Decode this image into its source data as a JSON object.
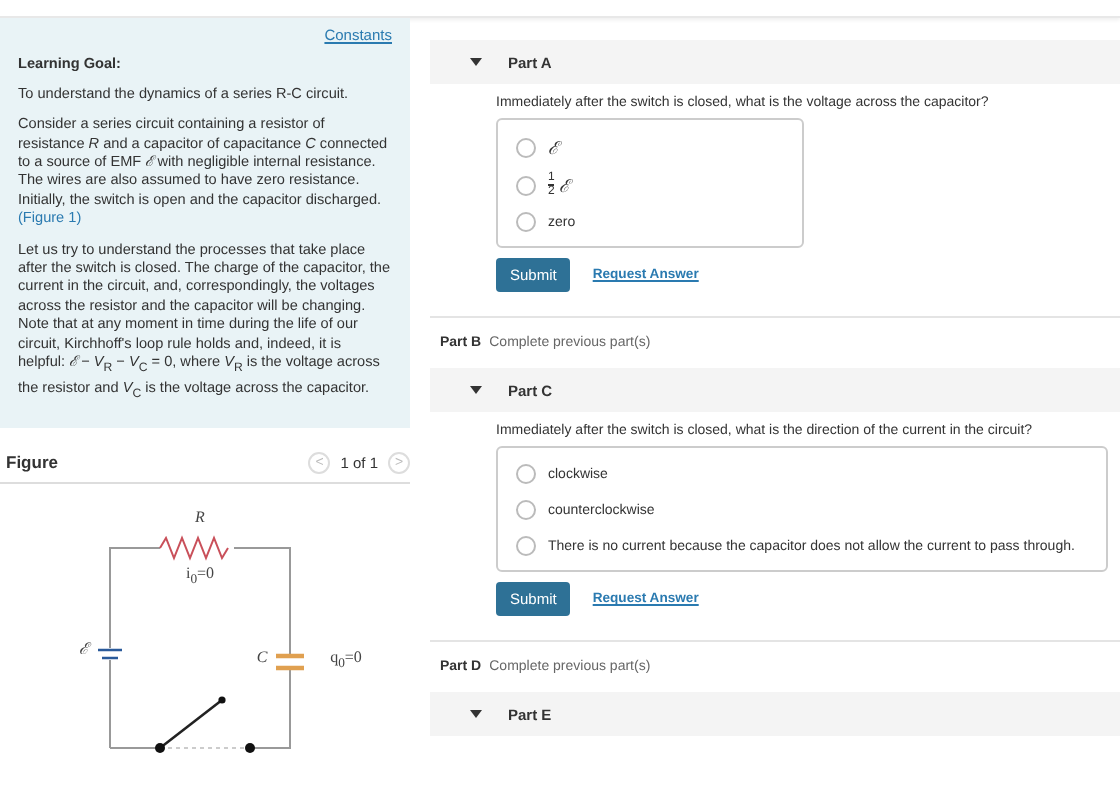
{
  "constants_link": "Constants",
  "intro": {
    "heading": "Learning Goal:",
    "paragraphs": [
      "To understand the dynamics of a series R-C circuit.",
      "Consider a series circuit containing a resistor of resistance *R* and a capacitor of capacitance *C* connected to a source of EMF *ℰ* with negligible internal resistance. The wires are also assumed to have zero resistance. Initially, the switch is open and the capacitor discharged.",
      "Let us try to understand the processes that take place after the switch is closed. The charge of the capacitor, the current in the circuit, and, correspondingly, the voltages across the resistor and the capacitor will be changing. Note that at any moment in time during the life of our circuit, Kirchhoff's loop rule holds and, indeed, it is helpful: *ℰ* − *V*$_{R}$ − *V*$_{C}$ = 0, where *V*$_{R}$ is the voltage across the resistor and *V*$_{C}$ is the voltage across the capacitor."
    ],
    "figure_link": "(Figure 1)"
  },
  "figure": {
    "title": "Figure",
    "pager": "1 of 1",
    "prev": "<",
    "next": ">",
    "labels": {
      "resistor": "R",
      "current": "i$_{0}$=0",
      "emf": "ℰ",
      "capacitor": "C",
      "charge": "q$_{0}$=0"
    }
  },
  "parts": [
    {
      "kind": "open",
      "title": "Part A",
      "question": "Immediately after the switch is closed, what is the voltage across the capacitor?",
      "options": [
        {
          "kind": "text",
          "label": "ℰ",
          "selected": false
        },
        {
          "kind": "fraction",
          "numerator": "1",
          "denominator": "2",
          "label": "ℰ",
          "selected": false
        },
        {
          "kind": "text",
          "label": "zero",
          "selected": false
        }
      ],
      "submit": "Submit",
      "request": "Request Answer"
    },
    {
      "kind": "locked",
      "title": "Part B",
      "note": "Complete previous part(s)"
    },
    {
      "kind": "open",
      "title": "Part C",
      "question": "Immediately after the switch is closed, what is the direction of the current in the circuit?",
      "options": [
        {
          "kind": "text",
          "label": "clockwise",
          "selected": false
        },
        {
          "kind": "text",
          "label": "counterclockwise",
          "selected": false
        },
        {
          "kind": "text",
          "label": "There is no current because the capacitor does not allow the current to pass through.",
          "selected": false
        }
      ],
      "submit": "Submit",
      "request": "Request Answer"
    },
    {
      "kind": "locked",
      "title": "Part D",
      "note": "Complete previous part(s)"
    },
    {
      "kind": "header",
      "title": "Part E"
    }
  ]
}
